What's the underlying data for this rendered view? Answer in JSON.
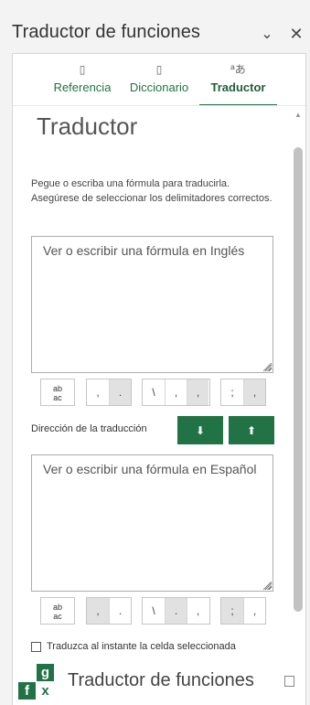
{
  "pane": {
    "title": "Traductor de funciones",
    "chevron_icon": "chevron-down-icon",
    "close_icon": "close-icon"
  },
  "tabs": [
    {
      "label": "Referencia",
      "icon": "reference-icon",
      "glyph": "▯",
      "active": false
    },
    {
      "label": "Diccionario",
      "icon": "dictionary-icon",
      "glyph": "▯",
      "active": false
    },
    {
      "label": "Traductor",
      "icon": "translate-icon",
      "glyph": "ªあ",
      "active": true
    }
  ],
  "translator": {
    "heading": "Traductor",
    "help_text": "Pegue o escriba una fórmula para traducirla. Asegúrese de seleccionar los delimitadores correctos.",
    "source_placeholder": "Ver o escribir una fórmula en Inglés",
    "direction_label": "Dirección de la traducción",
    "down_arrow": "⬇",
    "up_arrow": "⬆",
    "target_placeholder": "Ver o escribir una fórmula en Español",
    "instant_label": "Traduzca al instante la celda seleccionada",
    "abc_top": "ab",
    "abc_bottom": "ac",
    "source_delims": {
      "g1": [
        ",",
        "."
      ],
      "g2": [
        "\\",
        ",",
        ","
      ],
      "g3": [
        ";",
        ","
      ]
    },
    "target_delims": {
      "g1": [
        ",",
        "."
      ],
      "g2": [
        "\\",
        ".",
        ","
      ],
      "g3": [
        ";",
        ","
      ]
    }
  },
  "footer": {
    "logo_letters": [
      "",
      "g",
      "f",
      "x"
    ],
    "title": "Traductor de funciones"
  },
  "colors": {
    "accent": "#217346"
  }
}
